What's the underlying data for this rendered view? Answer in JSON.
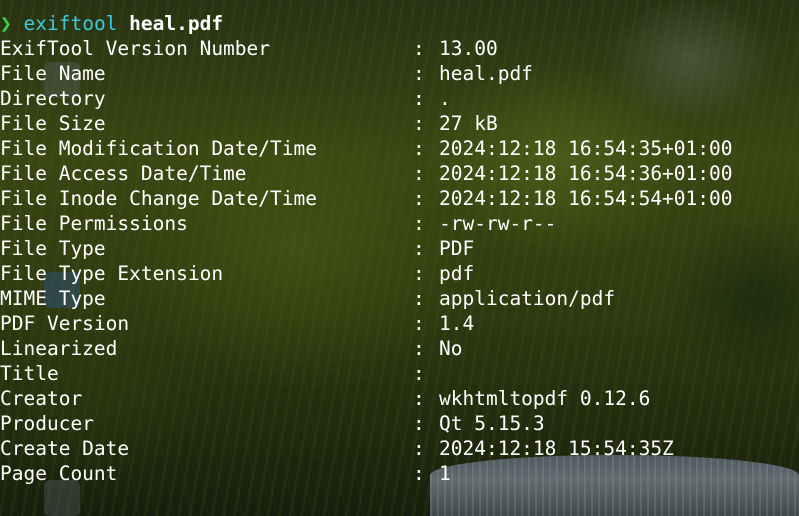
{
  "terminal": {
    "prompt_symbol": "❯",
    "command": "exiftool",
    "argument": "heal.pdf",
    "separator": ":",
    "rows": [
      {
        "key": "ExifTool Version Number",
        "value": "13.00"
      },
      {
        "key": "File Name",
        "value": "heal.pdf"
      },
      {
        "key": "Directory",
        "value": "."
      },
      {
        "key": "File Size",
        "value": "27 kB"
      },
      {
        "key": "File Modification Date/Time",
        "value": "2024:12:18 16:54:35+01:00"
      },
      {
        "key": "File Access Date/Time",
        "value": "2024:12:18 16:54:36+01:00"
      },
      {
        "key": "File Inode Change Date/Time",
        "value": "2024:12:18 16:54:54+01:00"
      },
      {
        "key": "File Permissions",
        "value": "-rw-rw-r--"
      },
      {
        "key": "File Type",
        "value": "PDF"
      },
      {
        "key": "File Type Extension",
        "value": "pdf"
      },
      {
        "key": "MIME Type",
        "value": "application/pdf"
      },
      {
        "key": "PDF Version",
        "value": "1.4"
      },
      {
        "key": "Linearized",
        "value": "No"
      },
      {
        "key": "Title",
        "value": ""
      },
      {
        "key": "Creator",
        "value": "wkhtmltopdf 0.12.6"
      },
      {
        "key": "Producer",
        "value": "Qt 5.15.3"
      },
      {
        "key": "Create Date",
        "value": "2024:12:18 15:54:35Z"
      },
      {
        "key": "Page Count",
        "value": "1"
      }
    ]
  },
  "colors": {
    "prompt": "#3fd14b",
    "command": "#3ec9d8",
    "text": "#ffffff"
  }
}
